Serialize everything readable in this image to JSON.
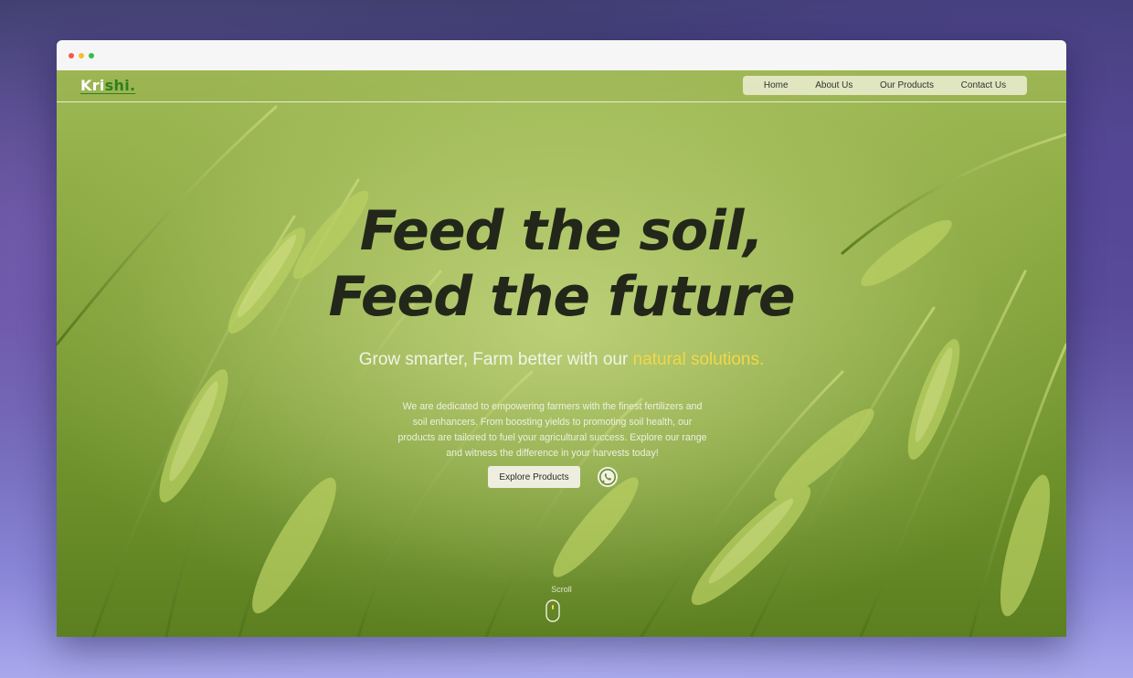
{
  "site": {
    "logo_main": "Kri",
    "logo_accent": "shi."
  },
  "nav": {
    "items": [
      {
        "label": "Home"
      },
      {
        "label": "About Us"
      },
      {
        "label": "Our Products"
      },
      {
        "label": "Contact Us"
      }
    ]
  },
  "hero": {
    "headline_line1": "Feed the soil,",
    "headline_line2": "Feed the future",
    "subline_plain": "Grow smarter, Farm better with our ",
    "subline_highlight": "natural solutions.",
    "description": "We are dedicated to empowering farmers with the finest fertilizers and soil enhancers. From boosting yields to promoting soil health, our products are tailored to fuel your agricultural success. Explore our range and witness the difference in your harvests today!",
    "cta_label": "Explore Products",
    "whatsapp_icon": "whatsapp-icon",
    "scroll_label": "Scroll"
  },
  "colors": {
    "accent_green": "#2f7f1b",
    "highlight_yellow": "#f2d84a",
    "headline": "#22271a"
  }
}
